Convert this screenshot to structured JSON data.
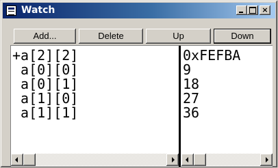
{
  "window": {
    "title": "Watch"
  },
  "toolbar": {
    "add_label": "Add...",
    "delete_label": "Delete",
    "up_label": "Up",
    "down_label": "Down"
  },
  "watch": {
    "names": [
      "+a[2][2]",
      " a[0][0]",
      " a[0][1]",
      " a[1][0]",
      " a[1][1]"
    ],
    "values": [
      "0xFEFBA",
      "9",
      "18",
      "27",
      "36"
    ]
  },
  "icons": {
    "window": "window-icon",
    "minimize": "minimize-icon",
    "maximize": "maximize-icon",
    "close": "close-icon",
    "scroll_left": "arrow-left-icon",
    "scroll_right": "arrow-right-icon"
  },
  "colors": {
    "titlebar_start": "#0a246a",
    "titlebar_end": "#a6caf0",
    "face": "#d4d0c8"
  }
}
